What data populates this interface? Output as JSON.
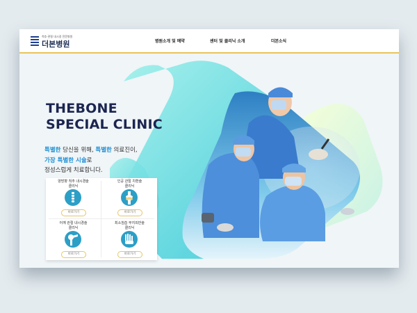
{
  "header": {
    "logo_sub": "척추·관절 내시경 전문병원",
    "logo_name": "더본병원",
    "nav": [
      "병원소개 및 예약",
      "센터 및 클리닉 소개",
      "더본소식"
    ]
  },
  "hero": {
    "title_line1": "THEBONE",
    "title_line2": "SPECIAL CLINIC",
    "desc1_hl1": "특별한",
    "desc1_mid": " 당신을 위해, ",
    "desc1_hl2": "특별한",
    "desc1_tail": " 의료진이,",
    "desc2_hl": "가장 특별한 시술",
    "desc2_tail": "로",
    "desc3": "정성스럽게 치료합니다."
  },
  "clinics": [
    {
      "line1": "양방향 척추 내시경술",
      "line2": "클리닉",
      "icon": "spine-icon",
      "button": "바로가기"
    },
    {
      "line1": "인공 관절 치환술",
      "line2": "클리닉",
      "icon": "knee-joint-icon",
      "button": "바로가기"
    },
    {
      "line1": "어깨 관절 내시경술",
      "line2": "클리닉",
      "icon": "shoulder-icon",
      "button": "바로가기"
    },
    {
      "line1": "최소침습 무지외반술",
      "line2": "클리닉",
      "icon": "foot-icon",
      "button": "바로가기"
    }
  ],
  "colors": {
    "accent": "#1f8fd4",
    "nav_border": "#e9c35a",
    "title": "#1b2550",
    "icon_circle": "#2c9fc7"
  }
}
